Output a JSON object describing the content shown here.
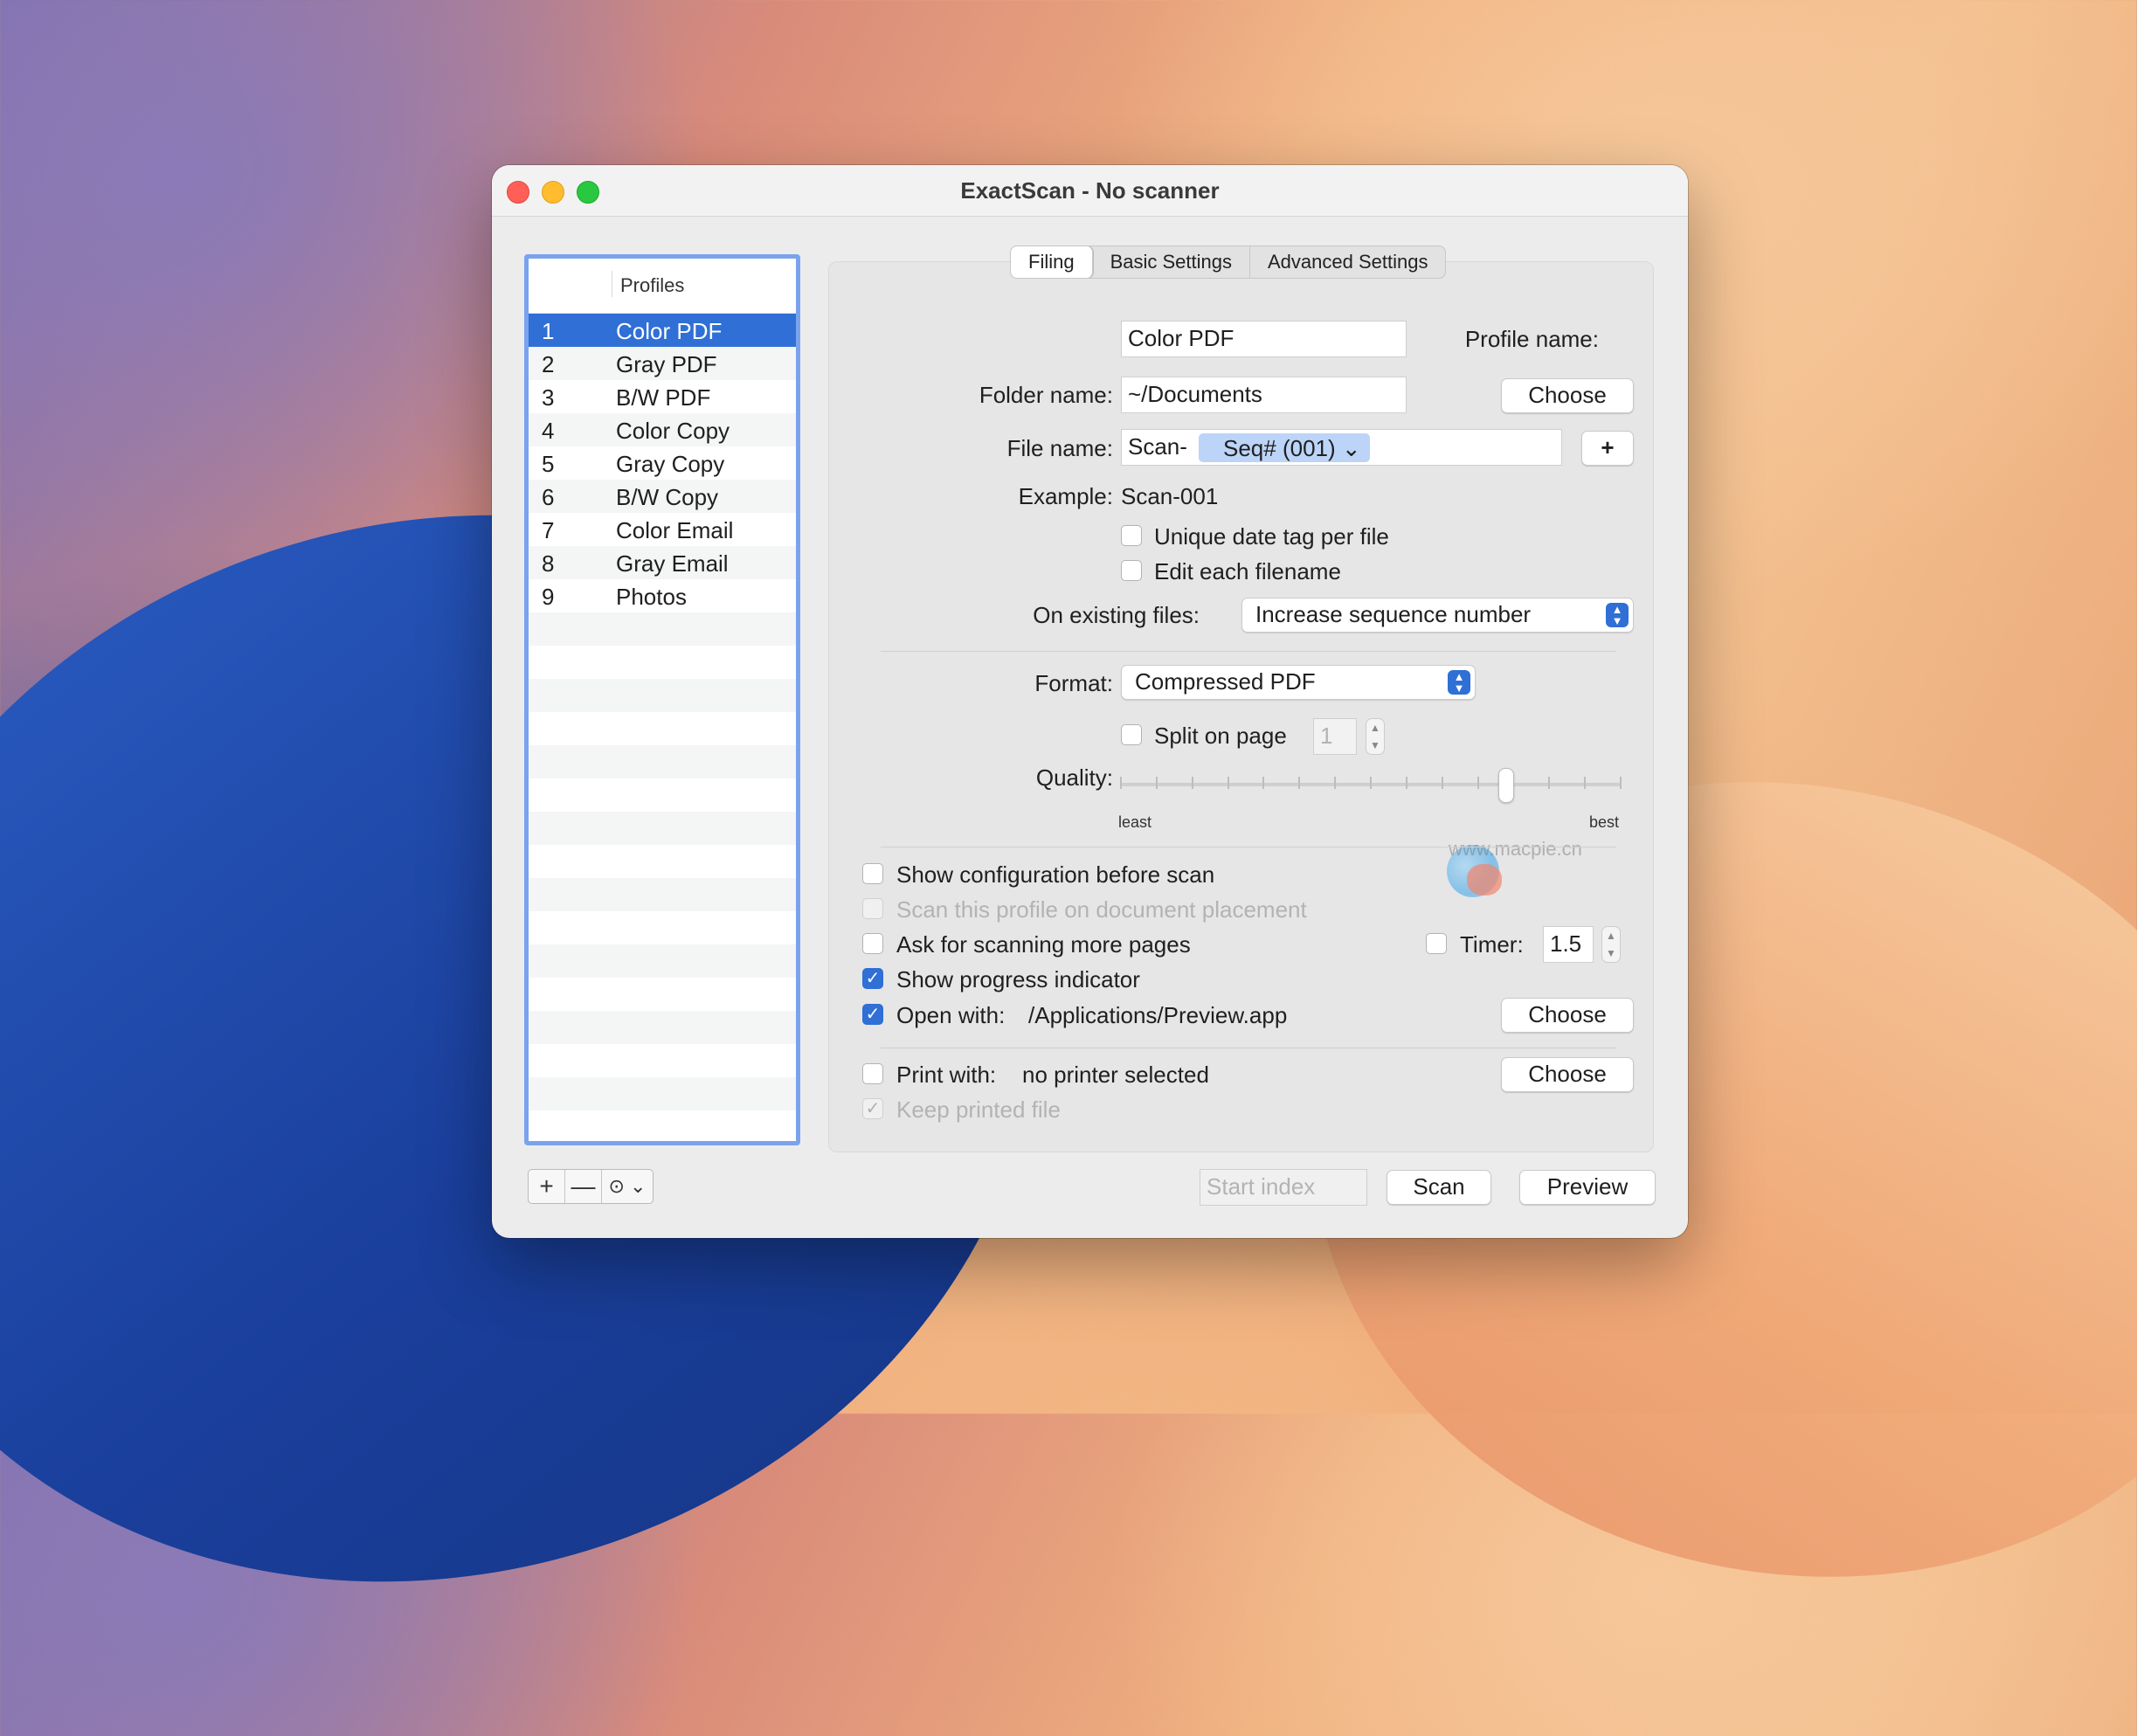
{
  "window": {
    "title": "ExactScan - No scanner"
  },
  "profiles": {
    "header": "Profiles",
    "items": [
      {
        "num": "1",
        "name": "Color PDF",
        "selected": true
      },
      {
        "num": "2",
        "name": "Gray PDF"
      },
      {
        "num": "3",
        "name": "B/W PDF"
      },
      {
        "num": "4",
        "name": "Color Copy"
      },
      {
        "num": "5",
        "name": "Gray Copy"
      },
      {
        "num": "6",
        "name": "B/W Copy"
      },
      {
        "num": "7",
        "name": "Color Email"
      },
      {
        "num": "8",
        "name": "Gray Email"
      },
      {
        "num": "9",
        "name": "Photos"
      }
    ],
    "buttons": {
      "add": "+",
      "remove": "—",
      "more": "⊙ ⌄"
    }
  },
  "tabs": [
    "Filing",
    "Basic Settings",
    "Advanced Settings"
  ],
  "filing": {
    "profile_name_label": "Profile name:",
    "profile_name_value": "Color PDF",
    "folder_name_label": "Folder name:",
    "folder_name_value": "~/Documents",
    "choose_label": "Choose",
    "file_name_label": "File name:",
    "file_name_prefix": "Scan-",
    "file_name_token": "Seq# (001) ⌄",
    "add_token_label": "+",
    "example_label": "Example:",
    "example_value": "Scan-001",
    "unique_date_label": "Unique date tag per file",
    "edit_each_label": "Edit each filename",
    "existing_files_label": "On existing files:",
    "existing_files_value": "Increase sequence number",
    "format_label": "Format:",
    "format_value": "Compressed PDF",
    "split_label": "Split on page",
    "split_value": "1",
    "quality_label": "Quality:",
    "quality_least": "least",
    "quality_best": "best",
    "quality_level": 0.77,
    "show_config_label": "Show configuration before scan",
    "scan_on_placement_label": "Scan this profile on document placement",
    "ask_more_label": "Ask for scanning more pages",
    "timer_label": "Timer:",
    "timer_value": "1.5",
    "progress_label": "Show progress indicator",
    "open_with_label": "Open with:",
    "open_with_value": "/Applications/Preview.app",
    "print_with_label": "Print with:",
    "print_with_value": "no printer selected",
    "keep_printed_label": "Keep printed file"
  },
  "bottom": {
    "start_index_placeholder": "Start index",
    "scan_label": "Scan",
    "preview_label": "Preview"
  },
  "watermark": {
    "text": "www.macpie.cn"
  }
}
